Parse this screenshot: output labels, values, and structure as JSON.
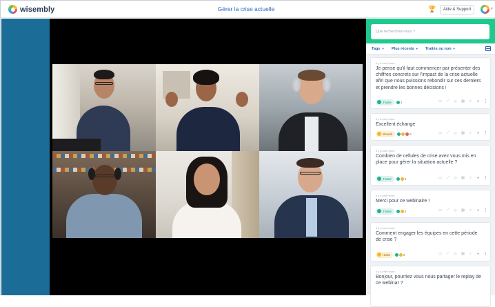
{
  "app": {
    "logo_text": "wisembly",
    "page_title": "Gérer la crise actuelle",
    "help_button": "Aide & Support",
    "trophy_icon": "trophy-icon",
    "brand_colors": {
      "accent_green": "#1ec98e",
      "sidebar_blue": "#1b6d98",
      "link_blue": "#2b5ea8"
    }
  },
  "video": {
    "participants_count": 6
  },
  "panel": {
    "search_placeholder": "Que recherchez-vous ?",
    "filters": [
      {
        "label": "Tags"
      },
      {
        "label": "Plus récents"
      },
      {
        "label": "Traités ou non"
      }
    ],
    "questions": [
      {
        "meta": "Il y a une heure",
        "text": "Je pense qu'il faut commencer par présenter des chiffres concrets sur l'impact de la crise actuelle afin que nous puissions rebondir sur ces derniers et prendre les bonnes décisions !",
        "pill_label": "J'aime",
        "pill_style": "teal",
        "reaction_count": "4"
      },
      {
        "meta": "Il y a une heure",
        "text": "Excellent échange",
        "pill_label": "Wouah",
        "pill_style": "gold",
        "reaction_count": "6"
      },
      {
        "meta": "Il y a une heure",
        "text": "Combien de cellules de crise avez vous mis en place pour gérer la situation actuelle ?",
        "pill_label": "J'aime",
        "pill_style": "teal",
        "reaction_count": "5"
      },
      {
        "meta": "Il y a une heure",
        "text": "Merci pour ce webinaire !",
        "pill_label": "J'aime",
        "pill_style": "teal",
        "reaction_count": "4"
      },
      {
        "meta": "Il y a une heure",
        "text": "Comment engager les équipes en cette période de crise ?",
        "pill_label": "Haha",
        "pill_style": "gold",
        "reaction_count": "3"
      },
      {
        "meta": "Il y a une heure",
        "text": "Bonjour, pourriez vous nous partager le replay de ce webinar ?"
      }
    ]
  }
}
